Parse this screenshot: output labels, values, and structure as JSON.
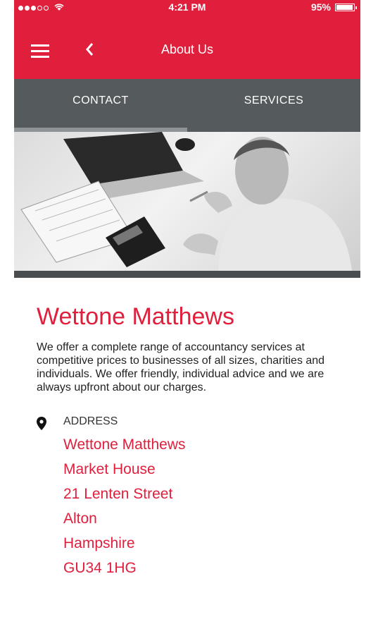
{
  "status_bar": {
    "time": "4:21 PM",
    "battery": "95%",
    "battery_level": 0.95
  },
  "navbar": {
    "title": "About Us",
    "menu_icon": "hamburger-icon",
    "back_icon": "chevron-left-icon"
  },
  "tabs": [
    {
      "label": "CONTACT",
      "active": true
    },
    {
      "label": "SERVICES",
      "active": false
    }
  ],
  "company": {
    "name": "Wettone Matthews",
    "description": "We offer a complete range of accountancy services at competitive prices to businesses of all sizes, charities and individuals. We offer friendly, individual advice and we are always upfront about our charges."
  },
  "address": {
    "label": "ADDRESS",
    "icon": "map-pin-icon",
    "lines": [
      "Wettone Matthews",
      "Market House",
      "21 Lenten Street",
      "Alton",
      "Hampshire",
      "GU34 1HG"
    ]
  },
  "colors": {
    "brand_red": "#e01f3d",
    "tab_bar": "#555a5c"
  }
}
